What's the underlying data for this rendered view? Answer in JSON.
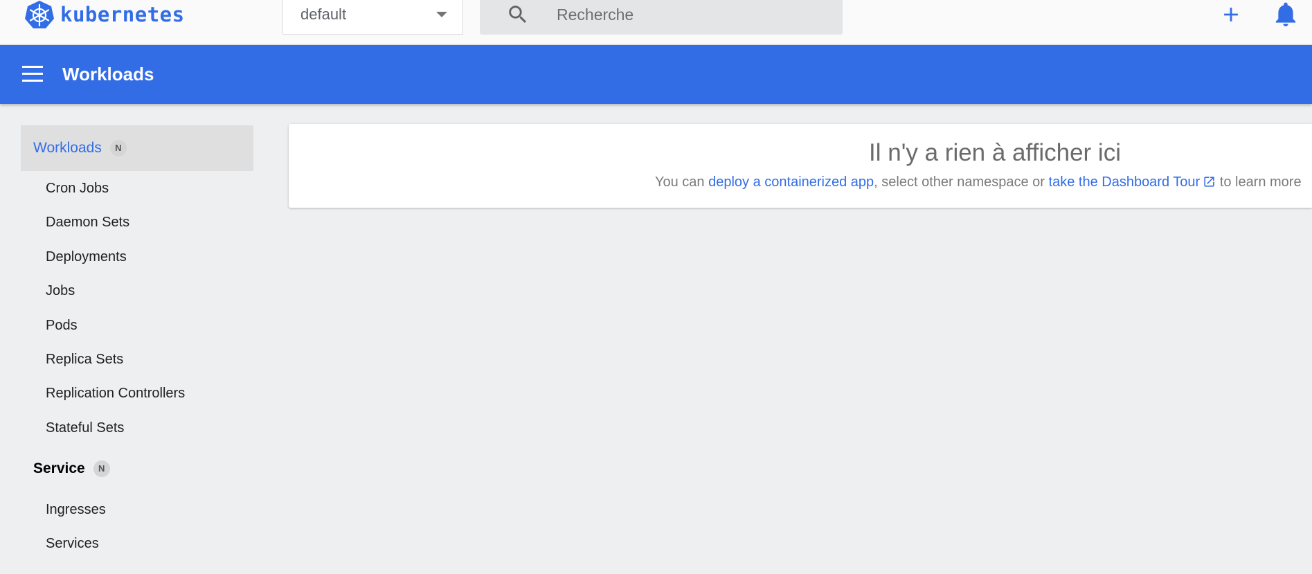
{
  "app": {
    "logo_text": "kubernetes",
    "brand_color": "#326de6"
  },
  "toolbar": {
    "namespace_value": "default",
    "search_placeholder": "Recherche",
    "icons": [
      "search-icon",
      "add-icon",
      "bell-icon"
    ]
  },
  "header": {
    "title": "Workloads"
  },
  "sidebar": {
    "groups": [
      {
        "label": "Workloads",
        "badge": "N",
        "active": true,
        "items": [
          {
            "label": "Cron Jobs"
          },
          {
            "label": "Daemon Sets"
          },
          {
            "label": "Deployments"
          },
          {
            "label": "Jobs"
          },
          {
            "label": "Pods"
          },
          {
            "label": "Replica Sets"
          },
          {
            "label": "Replication Controllers"
          },
          {
            "label": "Stateful Sets"
          }
        ]
      },
      {
        "label": "Service",
        "badge": "N",
        "active": false,
        "items": [
          {
            "label": "Ingresses"
          },
          {
            "label": "Services"
          }
        ]
      }
    ]
  },
  "main": {
    "empty_title": "Il n'y a rien à afficher ici",
    "message": {
      "prefix": "You can ",
      "link_deploy": "deploy a containerized app",
      "middle": ", select other namespace or ",
      "link_tour": "take the Dashboard Tour",
      "suffix": " to learn more"
    }
  }
}
